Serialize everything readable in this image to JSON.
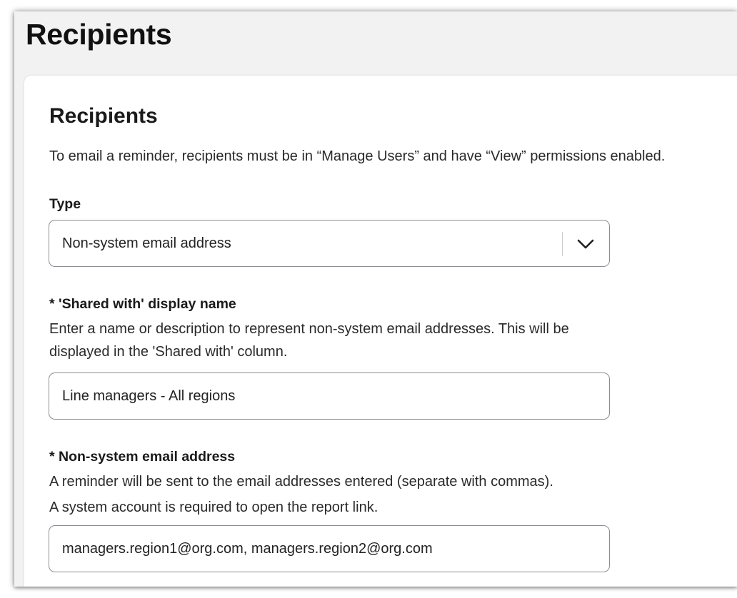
{
  "page": {
    "title": "Recipients"
  },
  "card": {
    "title": "Recipients",
    "intro": "To email a reminder, recipients must be in “Manage Users” and have “View” permissions enabled."
  },
  "type_field": {
    "label": "Type",
    "selected": "Non-system email address",
    "icon": "chevron-down-icon"
  },
  "display_name_field": {
    "label": "* 'Shared with' display name",
    "help": "Enter a name or description to represent non-system email addresses. This will be displayed in the 'Shared with' column.",
    "value": "Line managers - All regions"
  },
  "email_field": {
    "label": "* Non-system email address",
    "help_line1": "A reminder will be sent to the email addresses entered (separate with commas).",
    "help_line2": "A system account is required to open the report link.",
    "value": "managers.region1@org.com, managers.region2@org.com"
  },
  "colors": {
    "background": "#f2f2f3",
    "card": "#ffffff",
    "border": "#8a8d92",
    "text": "#1a1a1a"
  }
}
